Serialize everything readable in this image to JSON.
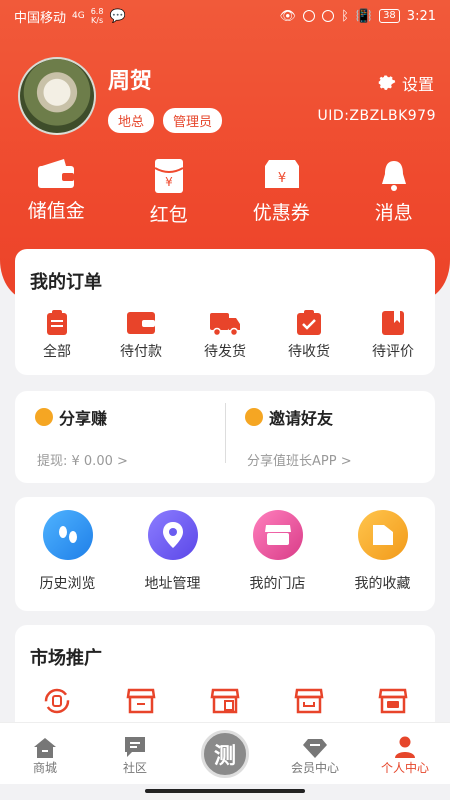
{
  "status": {
    "carrier": "中国移动",
    "net": "4G",
    "speed_value": "6.8",
    "speed_unit": "K/s",
    "battery": "38",
    "time": "3:21"
  },
  "profile": {
    "name": "周贺",
    "tags": [
      "地总",
      "管理员"
    ],
    "settings_label": "设置",
    "uid": "UID:ZBZLBK979"
  },
  "quick_actions": [
    {
      "label": "储值金",
      "icon": "wallet-icon"
    },
    {
      "label": "红包",
      "icon": "red-envelope-icon"
    },
    {
      "label": "优惠券",
      "icon": "coupon-icon"
    },
    {
      "label": "消息",
      "icon": "bell-icon"
    }
  ],
  "orders": {
    "title": "我的订单",
    "items": [
      {
        "label": "全部",
        "icon": "clipboard-icon"
      },
      {
        "label": "待付款",
        "icon": "wallet-icon"
      },
      {
        "label": "待发货",
        "icon": "truck-icon"
      },
      {
        "label": "待收货",
        "icon": "check-box-icon"
      },
      {
        "label": "待评价",
        "icon": "bookmark-icon"
      }
    ]
  },
  "share": {
    "left_title": "分享赚",
    "left_sub": "提现: ¥ 0.00  >",
    "right_title": "邀请好友",
    "right_sub": "分享值班长APP  >"
  },
  "tools": [
    {
      "label": "历史浏览",
      "icon": "footprint-icon",
      "color": "#2b8ef0"
    },
    {
      "label": "地址管理",
      "icon": "location-pin-icon",
      "color": "#6a5cf0"
    },
    {
      "label": "我的门店",
      "icon": "store-icon",
      "color": "#e8519a"
    },
    {
      "label": "我的收藏",
      "icon": "folder-icon",
      "color": "#f5a623"
    }
  ],
  "market": {
    "title": "市场推广",
    "icons": [
      "recycle-cup-icon",
      "store-icon",
      "store-doc-icon",
      "store-icon",
      "store-card-icon"
    ]
  },
  "tabbar": [
    {
      "label": "商城",
      "icon": "home-icon",
      "active": false
    },
    {
      "label": "社区",
      "icon": "chat-icon",
      "active": false
    },
    {
      "label": "测",
      "icon": "center-icon",
      "active": false
    },
    {
      "label": "会员中心",
      "icon": "diamond-icon",
      "active": false
    },
    {
      "label": "个人中心",
      "icon": "person-icon",
      "active": true
    }
  ],
  "colors": {
    "accent": "#ec4a2e",
    "card": "#ffffff",
    "background": "#f2f2f4"
  }
}
